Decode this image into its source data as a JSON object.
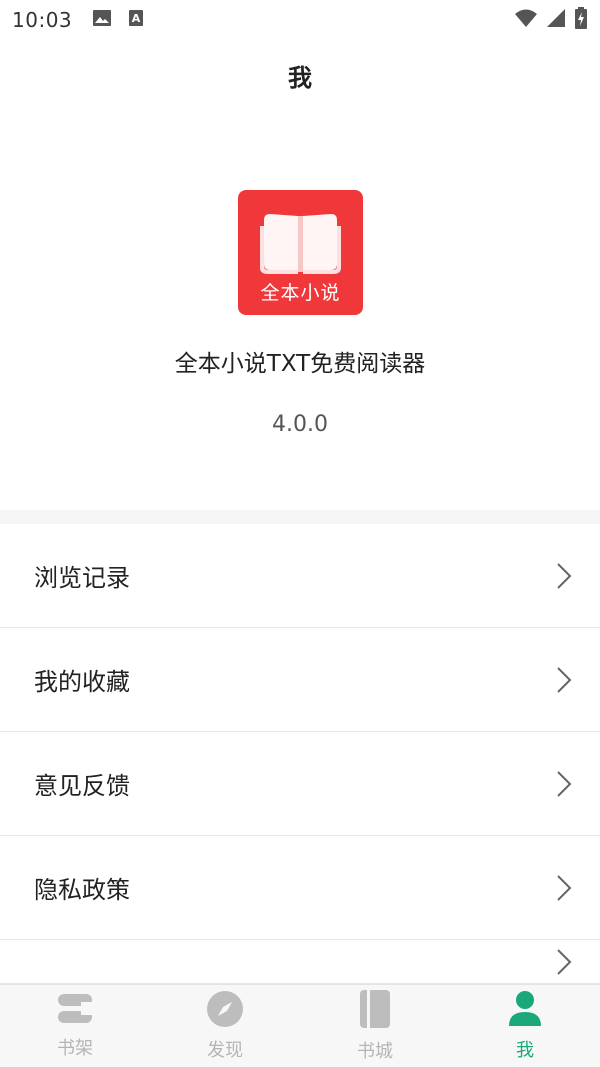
{
  "status_bar": {
    "time": "10:03",
    "icons": [
      "image-icon",
      "keyboard-a-icon",
      "wifi-icon",
      "signal-icon",
      "battery-charging-icon"
    ]
  },
  "header": {
    "title": "我"
  },
  "app_info": {
    "logo_text": "全本小说",
    "name": "全本小说TXT免费阅读器",
    "version": "4.0.0"
  },
  "menu": {
    "items": [
      {
        "label": "浏览记录",
        "icon": "chevron-right-icon"
      },
      {
        "label": "我的收藏",
        "icon": "chevron-right-icon"
      },
      {
        "label": "意见反馈",
        "icon": "chevron-right-icon"
      },
      {
        "label": "隐私政策",
        "icon": "chevron-right-icon"
      }
    ]
  },
  "bottom_nav": {
    "tabs": [
      {
        "label": "书架",
        "icon": "bookshelf-icon",
        "active": false
      },
      {
        "label": "发现",
        "icon": "compass-icon",
        "active": false
      },
      {
        "label": "书城",
        "icon": "book-icon",
        "active": false
      },
      {
        "label": "我",
        "icon": "person-icon",
        "active": true
      }
    ]
  },
  "colors": {
    "accent": "#1aa87a",
    "logo_bg": "#f0383b",
    "inactive_nav": "#b5b5b5"
  }
}
